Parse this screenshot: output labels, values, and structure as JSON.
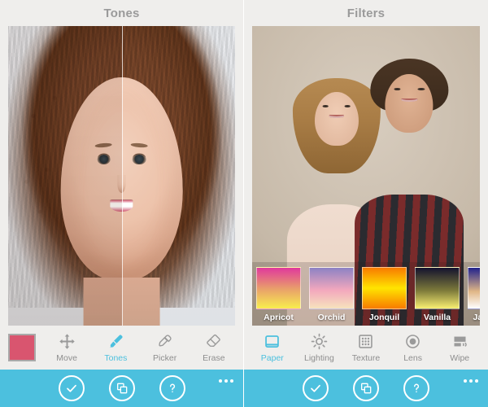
{
  "theme": {
    "accent": "#4cc0de",
    "panel_bg": "#efeeec",
    "tool_label": "#8e8e8e",
    "swatch_color": "#d9556f"
  },
  "panels": [
    {
      "id": "tones-panel",
      "title": "Tones",
      "swatch_color": "#d9556f",
      "tools": [
        {
          "label": "Move",
          "icon": "move-icon",
          "active": false
        },
        {
          "label": "Tones",
          "icon": "brush-icon",
          "active": true
        },
        {
          "label": "Picker",
          "icon": "eyedropper-icon",
          "active": false
        },
        {
          "label": "Erase",
          "icon": "eraser-icon",
          "active": false
        }
      ]
    },
    {
      "id": "filters-panel",
      "title": "Filters",
      "tools": [
        {
          "label": "Paper",
          "icon": "paper-icon",
          "active": true
        },
        {
          "label": "Lighting",
          "icon": "sun-icon",
          "active": false
        },
        {
          "label": "Texture",
          "icon": "texture-grid-icon",
          "active": false
        },
        {
          "label": "Lens",
          "icon": "lens-icon",
          "active": false
        },
        {
          "label": "Wipe",
          "icon": "wipe-icon",
          "active": false
        }
      ],
      "filters": [
        {
          "label": "Apricot",
          "colors": [
            "#e0399c",
            "#e9a06a",
            "#f8ee4e"
          ]
        },
        {
          "label": "Orchid",
          "colors": [
            "#8d82c4",
            "#f3a8bd",
            "#f6e3bd"
          ]
        },
        {
          "label": "Jonquil",
          "colors": [
            "#f87b00",
            "#ffe400",
            "#f87b00"
          ]
        },
        {
          "label": "Vanilla",
          "colors": [
            "#14132e",
            "#7d7a3a",
            "#f9ef72"
          ]
        },
        {
          "label": "Jasmine",
          "colors": [
            "#21228c",
            "#e0b686",
            "#ffffff"
          ]
        }
      ]
    }
  ],
  "appbar": {
    "buttons": [
      {
        "label": "Apply",
        "icon": "check-icon"
      },
      {
        "label": "Layers",
        "icon": "layers-icon"
      },
      {
        "label": "Help",
        "icon": "question-icon"
      }
    ],
    "more_label": "More"
  }
}
